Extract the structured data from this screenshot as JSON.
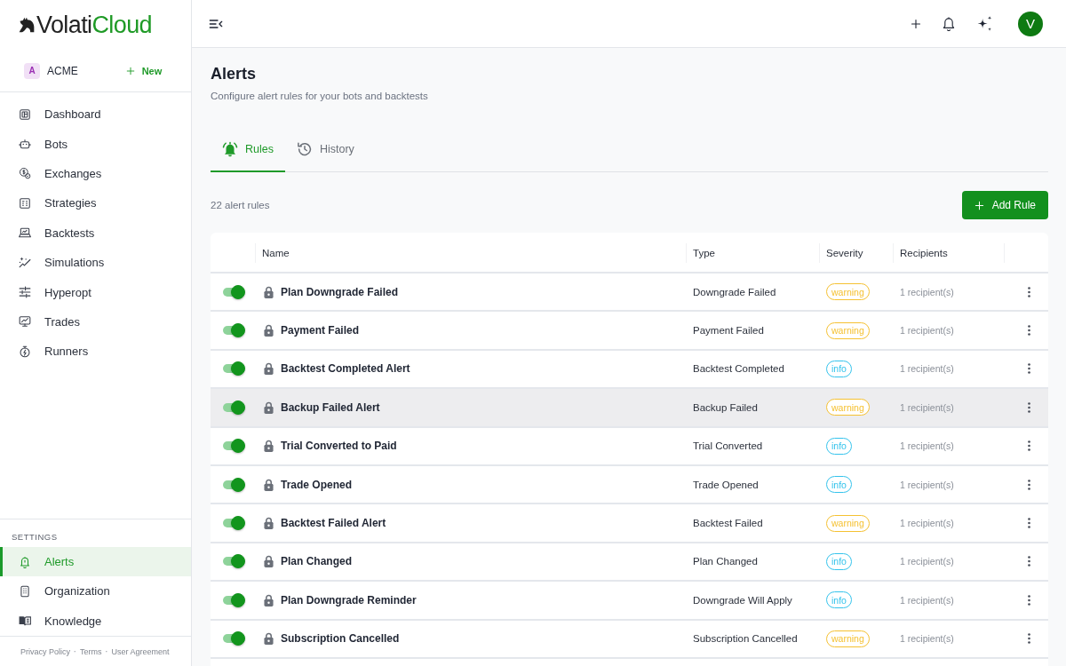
{
  "sidebar": {
    "logo": {
      "wordmark": "Volati",
      "wordmark_accent": "Cloud"
    },
    "organization": {
      "avatar": "A",
      "name": "ACME"
    },
    "new_button": "New",
    "nav": [
      {
        "label": "Dashboard",
        "selected": false
      },
      {
        "label": "Bots",
        "selected": false
      },
      {
        "label": "Exchanges",
        "selected": false
      },
      {
        "label": "Strategies",
        "selected": false
      },
      {
        "label": "Backtests",
        "selected": false
      },
      {
        "label": "Simulations",
        "selected": false
      },
      {
        "label": "Hyperopt",
        "selected": false
      },
      {
        "label": "Trades",
        "selected": false
      },
      {
        "label": "Runners",
        "selected": false
      }
    ],
    "settings": {
      "heading": "SETTINGS",
      "items": [
        {
          "label": "Alerts",
          "selected": true
        },
        {
          "label": "Organization",
          "selected": false
        },
        {
          "label": "Knowledge",
          "selected": false
        }
      ]
    },
    "footer_links": [
      {
        "kind": "link",
        "text": "Privacy Policy"
      },
      {
        "kind": "separator",
        "text": "·"
      },
      {
        "kind": "link",
        "text": "Terms"
      },
      {
        "kind": "separator",
        "text": "·"
      },
      {
        "kind": "link",
        "text": "User Agreement"
      }
    ]
  },
  "top_bar": {
    "avatar": "V"
  },
  "page": {
    "title": "Alerts",
    "subtitle": "Configure alert rules for your bots and backtests"
  },
  "tabs": [
    {
      "label": "Rules",
      "selected": true
    },
    {
      "label": "History",
      "selected": false
    }
  ],
  "toolbar": {
    "count": "22 alert rules",
    "add_button": "Add Rule"
  },
  "table": {
    "columns": [
      "Name",
      "Type",
      "Severity",
      "Recipients"
    ],
    "rows": [
      {
        "on": true,
        "locked": true,
        "hovered": false,
        "name": "Plan Downgrade Failed",
        "type": "Downgrade Failed",
        "severity": {
          "text": "warning",
          "color": "#f5c132"
        },
        "recipients": "1 recipient(s)"
      },
      {
        "on": true,
        "locked": true,
        "hovered": false,
        "name": "Payment Failed",
        "type": "Payment Failed",
        "severity": {
          "text": "warning",
          "color": "#f5c132"
        },
        "recipients": "1 recipient(s)"
      },
      {
        "on": true,
        "locked": true,
        "hovered": false,
        "name": "Backtest Completed Alert",
        "type": "Backtest Completed",
        "severity": {
          "text": "info",
          "color": "#34c3ec"
        },
        "recipients": "1 recipient(s)"
      },
      {
        "on": true,
        "locked": true,
        "hovered": true,
        "name": "Backup Failed Alert",
        "type": "Backup Failed",
        "severity": {
          "text": "warning",
          "color": "#f5c132"
        },
        "recipients": "1 recipient(s)"
      },
      {
        "on": true,
        "locked": true,
        "hovered": false,
        "name": "Trial Converted to Paid",
        "type": "Trial Converted",
        "severity": {
          "text": "info",
          "color": "#34c3ec"
        },
        "recipients": "1 recipient(s)"
      },
      {
        "on": true,
        "locked": true,
        "hovered": false,
        "name": "Trade Opened",
        "type": "Trade Opened",
        "severity": {
          "text": "info",
          "color": "#34c3ec"
        },
        "recipients": "1 recipient(s)"
      },
      {
        "on": true,
        "locked": true,
        "hovered": false,
        "name": "Backtest Failed Alert",
        "type": "Backtest Failed",
        "severity": {
          "text": "warning",
          "color": "#f5c132"
        },
        "recipients": "1 recipient(s)"
      },
      {
        "on": true,
        "locked": true,
        "hovered": false,
        "name": "Plan Changed",
        "type": "Plan Changed",
        "severity": {
          "text": "info",
          "color": "#34c3ec"
        },
        "recipients": "1 recipient(s)"
      },
      {
        "on": true,
        "locked": true,
        "hovered": false,
        "name": "Plan Downgrade Reminder",
        "type": "Downgrade Will Apply",
        "severity": {
          "text": "info",
          "color": "#34c3ec"
        },
        "recipients": "1 recipient(s)"
      },
      {
        "on": true,
        "locked": true,
        "hovered": false,
        "name": "Subscription Cancelled",
        "type": "Subscription Cancelled",
        "severity": {
          "text": "warning",
          "color": "#f5c132"
        },
        "recipients": "1 recipient(s)"
      }
    ]
  }
}
